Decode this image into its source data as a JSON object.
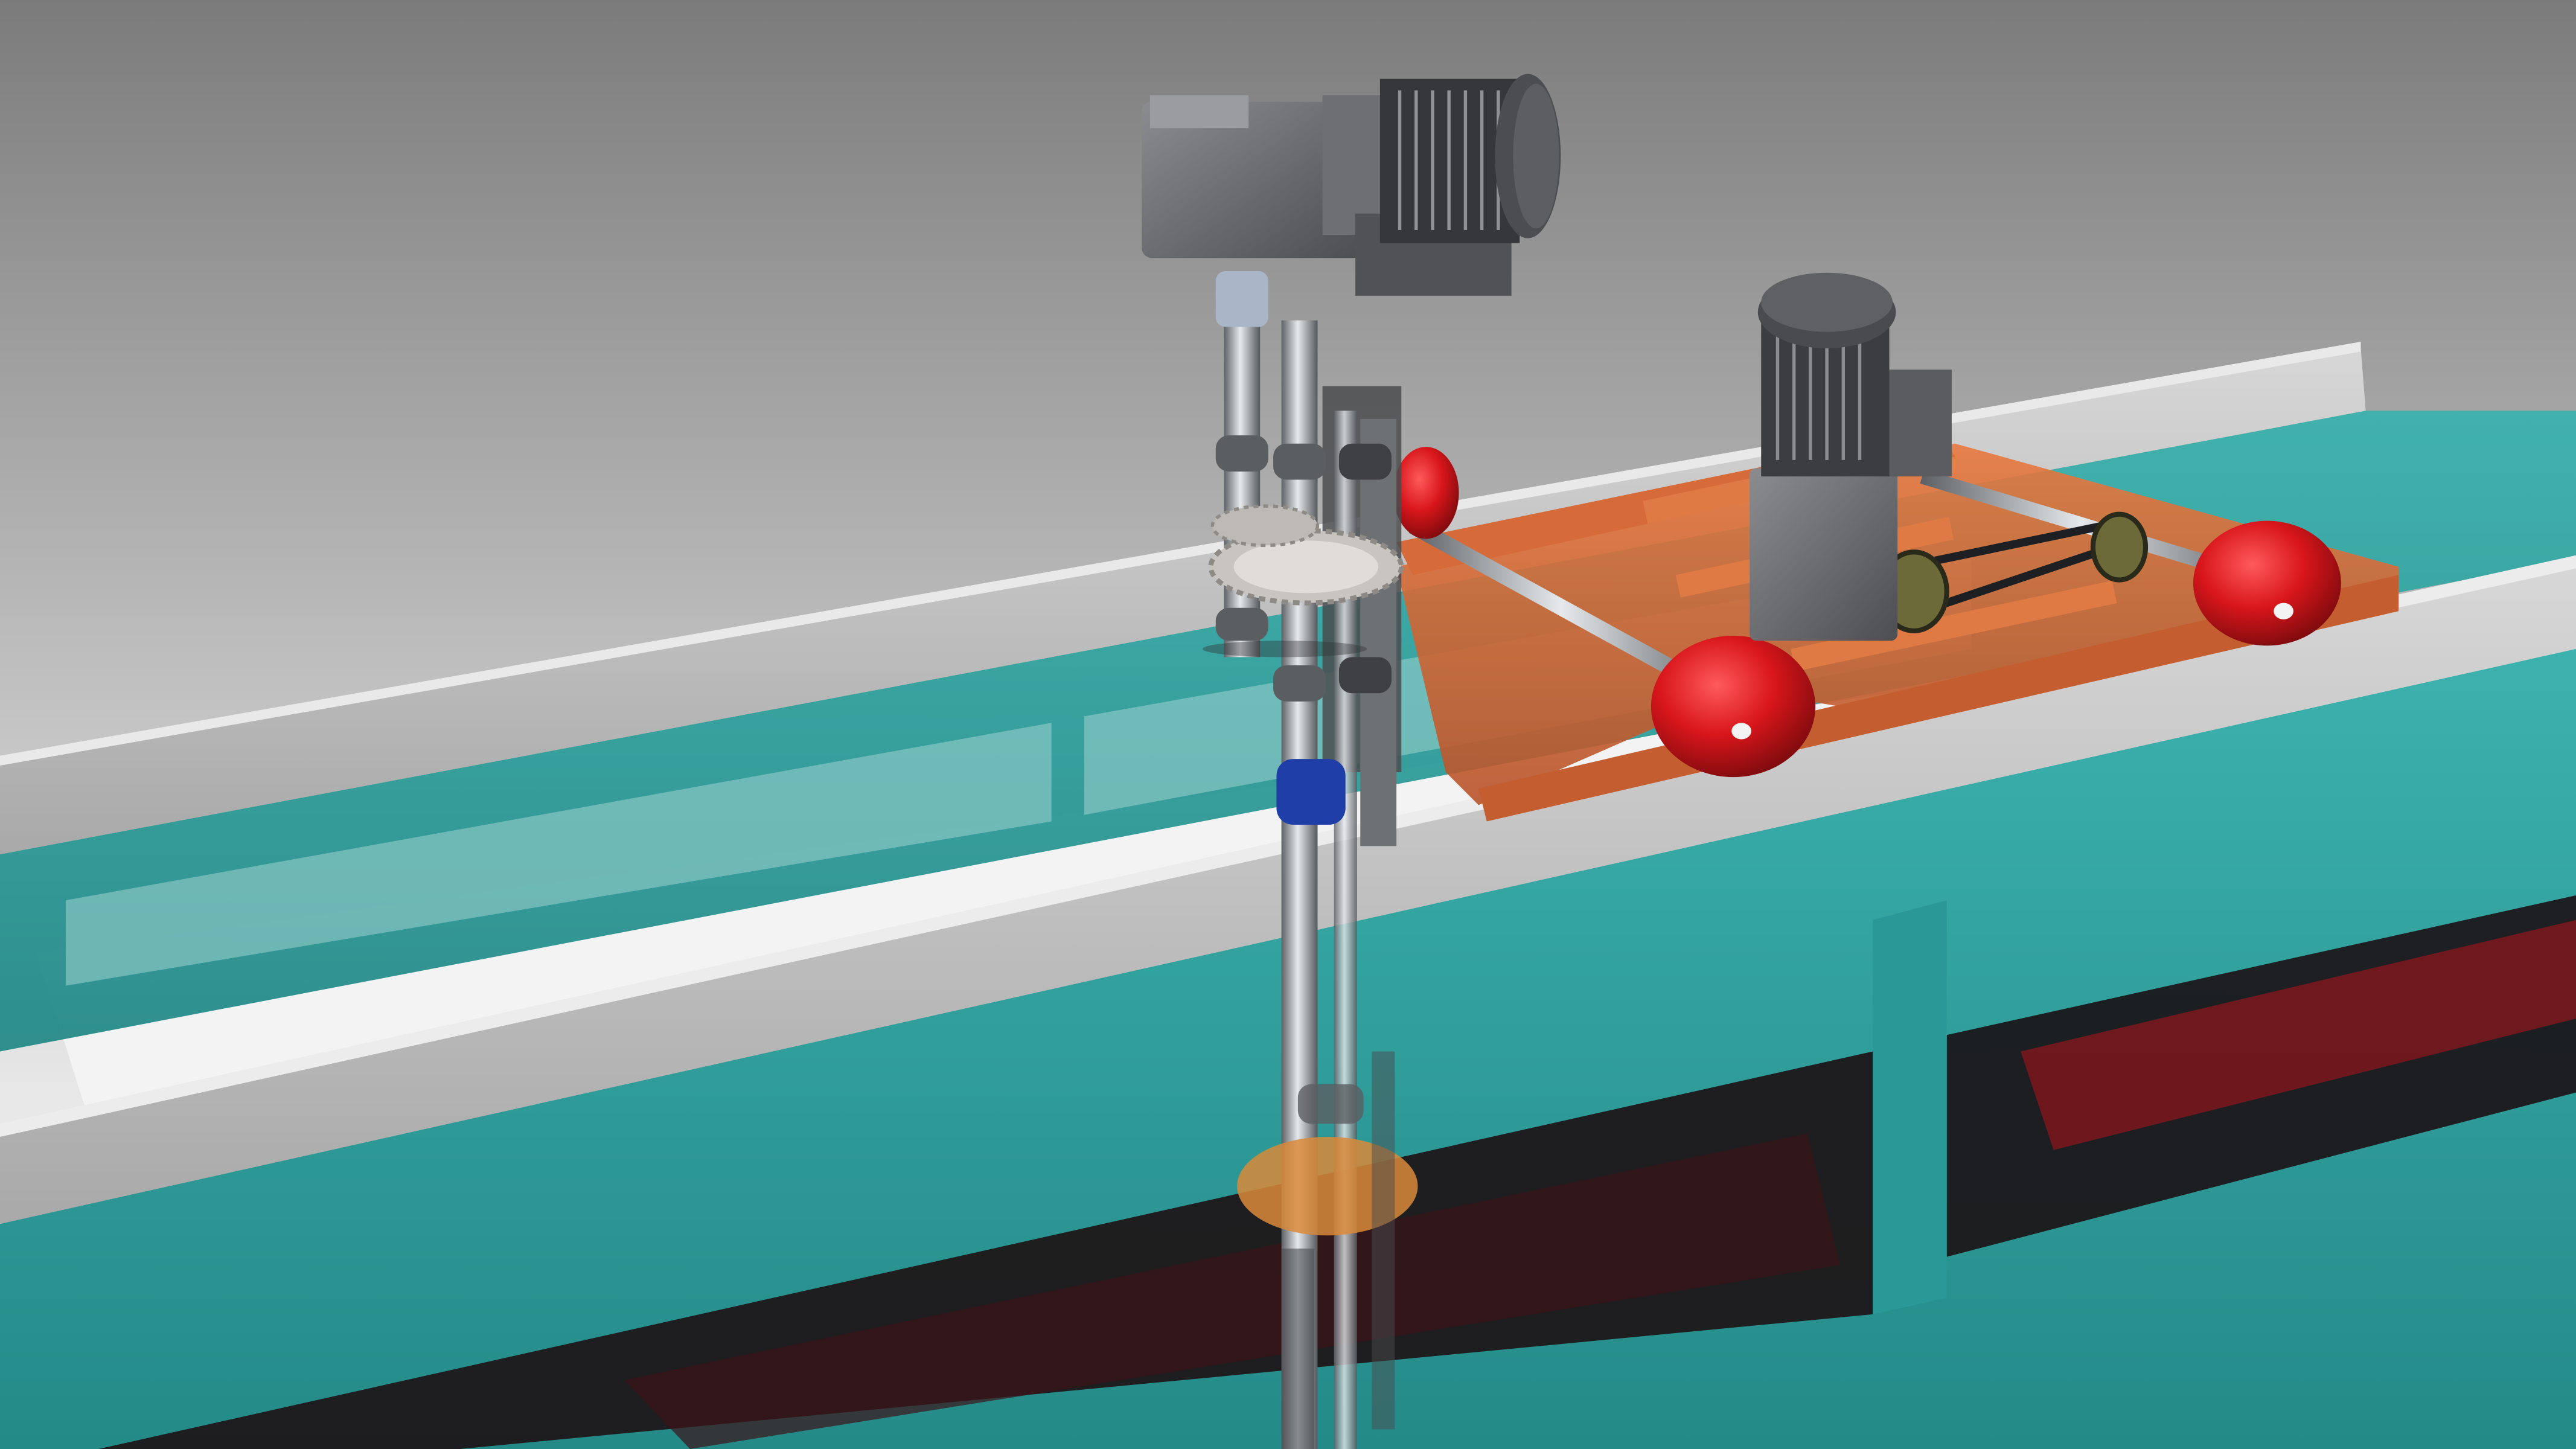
{
  "scene": {
    "colors": {
      "background_top": "#7d7d7d",
      "background_bottom": "#f2f2f2",
      "tank_frame": "#2e9a9a",
      "tank_frame_light": "#3ab1ad",
      "rail": "#bdbdbd",
      "carriage_frame": "#d9683a",
      "wheel": "#d8161b",
      "motor_body": "#6b6d70",
      "motor_dark": "#3a3b3d",
      "shaft": "#9da3a8",
      "gear": "#c8c5c0",
      "coupling_blue": "#1f3ea8",
      "pulley": "#6d6a3a",
      "water_dark": "#1a1114",
      "water_red": "#b3141b",
      "float_disc": "#d98a3a"
    },
    "icons": [
      "geared-motor-icon",
      "motor-icon",
      "wheel-icon",
      "gear-icon"
    ]
  }
}
